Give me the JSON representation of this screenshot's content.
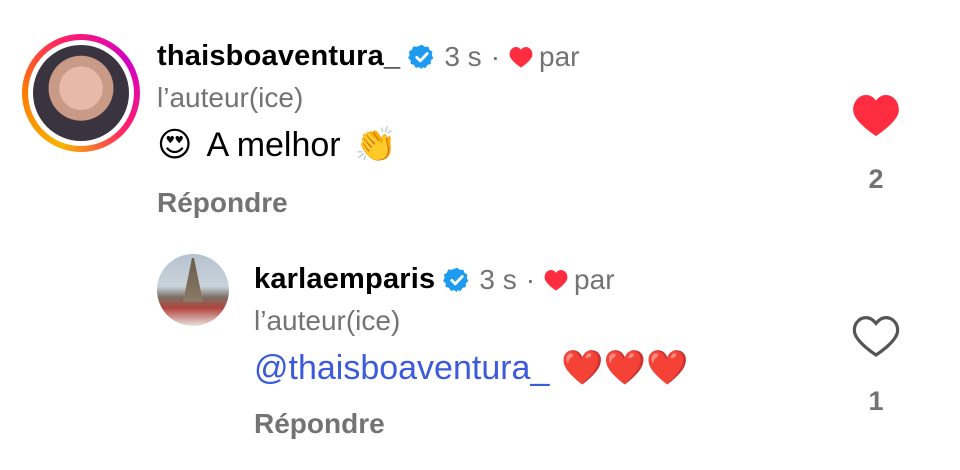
{
  "comments": [
    {
      "username": "thaisboaventura_",
      "time": "3 s",
      "liked_by_label": "par",
      "author_tag": "l’auteur(ice)",
      "text_before": "😍",
      "text": "A melhor",
      "text_after": "👏",
      "reply_label": "Répondre",
      "like_count": "2",
      "liked": true
    },
    {
      "username": "karlaemparis",
      "time": "3 s",
      "liked_by_label": "par",
      "author_tag": "l’auteur(ice)",
      "mention": "@thaisboaventura_",
      "hearts": "❤️❤️❤️",
      "reply_label": "Répondre",
      "like_count": "1",
      "liked": false
    }
  ],
  "colors": {
    "like_red": "#ff2d3f",
    "muted": "#737373",
    "mention_blue": "#3b5bdb",
    "verified_blue": "#1d9bf0"
  },
  "icons": {
    "verified": "verified-badge-icon",
    "heart_filled": "heart-filled-icon",
    "heart_outline": "heart-outline-icon"
  }
}
